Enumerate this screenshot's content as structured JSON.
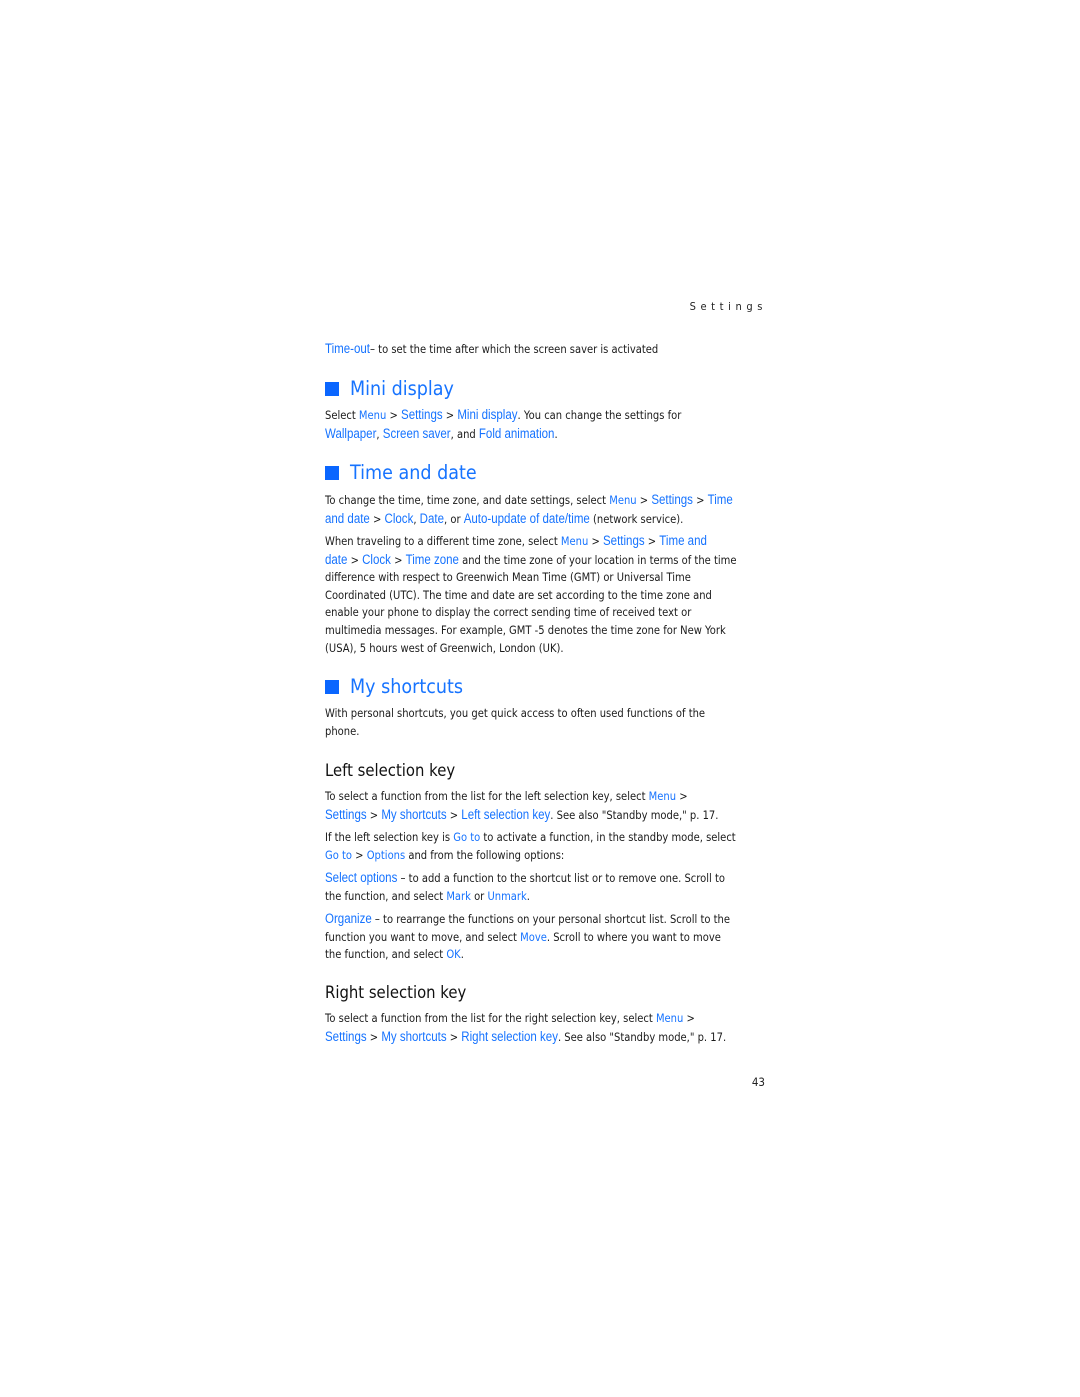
{
  "running_head": "Settings",
  "page_number": "43",
  "accent_color": "#1673ff",
  "timeout": {
    "term": "Time-out",
    "text": "– to set the time after which the screen saver is activated"
  },
  "mini_display": {
    "heading": "Mini display",
    "l1": {
      "a": "Select ",
      "menu": "Menu",
      "b": " > ",
      "settings": "Settings",
      "c": " > ",
      "mini": "Mini display",
      "d": ". You can change the settings for"
    },
    "l2": {
      "wallpaper": "Wallpaper",
      "a": ", ",
      "saver": "Screen saver",
      "b": ", and ",
      "fold": "Fold animation",
      "c": "."
    }
  },
  "time_date": {
    "heading": "Time and date",
    "p1l1": {
      "a": "To change the time, time zone, and date settings, select ",
      "menu": "Menu",
      "b": " > ",
      "settings": "Settings",
      "c": " > ",
      "time": "Time"
    },
    "p1l2": {
      "and_date": "and date",
      "a": " > ",
      "clock": "Clock",
      "b": ", ",
      "date": "Date",
      "c": ", or ",
      "auto": "Auto-update of date/time",
      "d": " (network service)."
    },
    "p2l1": {
      "a": "When traveling to a different time zone, select ",
      "menu": "Menu",
      "b": " > ",
      "settings": "Settings",
      "c": " > ",
      "time_and": "Time and"
    },
    "p2l2": {
      "date": "date",
      "a": " > ",
      "clock": "Clock",
      "b": " > ",
      "zone": "Time zone",
      "c": " and the time zone of your location in terms of the time"
    },
    "p2_rest": [
      "difference with respect to Greenwich Mean Time (GMT) or Universal Time",
      "Coordinated (UTC). The time and date are set according to the time zone and",
      "enable your phone to display the correct sending time of received text or",
      "multimedia messages. For example, GMT -5 denotes the time zone for New York",
      "(USA), 5 hours west of Greenwich, London (UK)."
    ]
  },
  "my_shortcuts": {
    "heading": "My shortcuts",
    "intro": [
      "With personal shortcuts, you get quick access to often used functions of the",
      "phone."
    ]
  },
  "left_key": {
    "heading": "Left selection key",
    "p1l1": {
      "a": "To select a function from the list for the left selection key, select ",
      "menu": "Menu",
      "b": " >"
    },
    "p1l2": {
      "settings": "Settings",
      "a": " > ",
      "short": "My shortcuts",
      "b": " > ",
      "key": "Left selection key",
      "c": ". See also \"Standby mode,\" p. 17."
    },
    "p2l1": {
      "a": "If the left selection key is ",
      "goto": "Go to",
      "b": " to activate a function, in the standby mode, select"
    },
    "p2l2": {
      "goto": "Go to",
      "a": "  > ",
      "options": "Options",
      "b": " and from the following options:"
    },
    "opt1l1": {
      "term": "Select options",
      "a": " – to add a function to the shortcut list or to remove one. Scroll to"
    },
    "opt1l2": {
      "a": "the function, and select ",
      "mark": "Mark",
      "b": " or ",
      "unmark": "Unmark",
      "c": "."
    },
    "opt2l1": {
      "term": "Organize",
      "a": " – to rearrange the functions on your personal shortcut list. Scroll to the"
    },
    "opt2l2": {
      "a": "function you want to move, and select ",
      "move": "Move",
      "b": ". Scroll to where you want to move"
    },
    "opt2l3": {
      "a": "the function, and select ",
      "ok": "OK",
      "b": "."
    }
  },
  "right_key": {
    "heading": "Right selection key",
    "p1l1": {
      "a": "To select a function from the list for the right selection key, select ",
      "menu": "Menu",
      "b": " >"
    },
    "p1l2": {
      "settings": "Settings",
      "a": " > ",
      "short": "My shortcuts",
      "b": " > ",
      "key": "Right selection key",
      "c": ". See also \"Standby mode,\" p. 17."
    }
  }
}
